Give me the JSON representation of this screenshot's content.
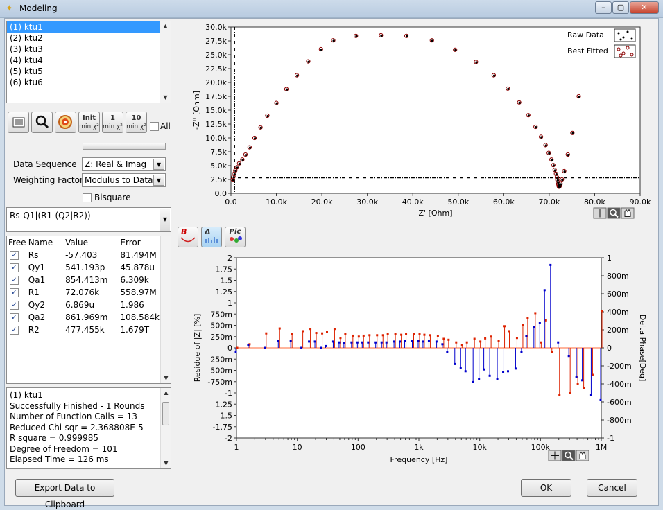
{
  "window": {
    "title": "Modeling"
  },
  "datasets": [
    "(1) ktu1",
    "(2) ktu2",
    "(3) ktu3",
    "(4) ktu4",
    "(5) ktu5",
    "(6) ktu6"
  ],
  "toolbar": {
    "init_label": "Init",
    "init_sub": "min χ²",
    "one_label": "1",
    "one_sub": "min χ²",
    "ten_label": "10",
    "ten_sub": "min χ²",
    "all_label": "All"
  },
  "settings": {
    "data_sequence_label": "Data Sequence",
    "data_sequence_value": "Z: Real & Imag",
    "weighting_label": "Weighting Factor",
    "weighting_value": "Modulus to Data",
    "bisquare_label": "Bisquare"
  },
  "circuit": {
    "value": "Rs-Q1|(R1-(Q2|R2))"
  },
  "params": {
    "headers": [
      "Free",
      "Name",
      "Value",
      "Error"
    ],
    "rows": [
      [
        "Rs",
        "-57.403",
        "81.494M"
      ],
      [
        "Qy1",
        "541.193p",
        "45.878u"
      ],
      [
        "Qa1",
        "854.413m",
        "6.309k"
      ],
      [
        "R1",
        "72.076k",
        "558.97M"
      ],
      [
        "Qy2",
        "6.869u",
        "1.986"
      ],
      [
        "Qa2",
        "861.969m",
        "108.584k"
      ],
      [
        "R2",
        "477.455k",
        "1.679T"
      ]
    ]
  },
  "log": {
    "lines": [
      "(1) ktu1",
      "Successfully Finished - 1 Rounds",
      "Number of Function Calls = 13",
      "Reduced Chi-sqr = 2.368808E-5",
      "R square = 0.999985",
      "Degree of Freedom = 101",
      "Elapsed Time = 126 ms"
    ]
  },
  "buttons": {
    "export": "Export Data to Clipboard",
    "ok": "OK",
    "cancel": "Cancel"
  },
  "midtools": {
    "b": "B",
    "delta": "Δ",
    "pic": "Pic"
  },
  "colors": {
    "raw": "#000000",
    "fit": "#8b0000",
    "residual_z": "#dd2200",
    "residual_phase": "#0000cc",
    "accent": "#3399ff"
  },
  "chart_data": [
    {
      "type": "scatter",
      "title": "",
      "xlabel": "Z' [Ohm]",
      "ylabel": "-Z'' [Ohm]",
      "xlim": [
        0,
        90000
      ],
      "ylim": [
        0,
        30000
      ],
      "x_ticks": [
        "0.0",
        "10.0k",
        "20.0k",
        "30.0k",
        "40.0k",
        "50.0k",
        "60.0k",
        "70.0k",
        "80.0k",
        "90.0k"
      ],
      "y_ticks": [
        "0.0",
        "2.5k",
        "5.0k",
        "7.5k",
        "10.0k",
        "12.5k",
        "15.0k",
        "17.5k",
        "20.0k",
        "22.5k",
        "25.0k",
        "27.5k",
        "30.0k"
      ],
      "legend_position": "top-right",
      "grid": false,
      "cursor": {
        "x": 800,
        "y": 2800
      },
      "series": [
        {
          "name": "Raw Data",
          "x": [
            400,
            550,
            700,
            950,
            1300,
            1800,
            2500,
            3200,
            4100,
            5200,
            6500,
            8000,
            10000,
            12200,
            14500,
            17000,
            19800,
            22500,
            27500,
            33000,
            38600,
            44200,
            49300,
            53900,
            57800,
            60900,
            63400,
            65400,
            67000,
            68200,
            69200,
            69900,
            70500,
            70900,
            71200,
            71500,
            71700,
            71800,
            71900,
            72000,
            72050,
            72100,
            72150,
            72200,
            72300,
            72500,
            72800,
            73300,
            74100,
            75100,
            76500
          ],
          "y": [
            2500,
            3000,
            3500,
            4100,
            4700,
            5400,
            6100,
            7000,
            8300,
            10000,
            11900,
            14000,
            16300,
            18800,
            21300,
            23800,
            26000,
            27600,
            28400,
            28500,
            28400,
            27600,
            25900,
            23700,
            21300,
            18900,
            16400,
            14100,
            12000,
            10200,
            8700,
            7300,
            6100,
            5100,
            4200,
            3500,
            2900,
            2400,
            2000,
            1700,
            1500,
            1300,
            1200,
            1200,
            1300,
            1700,
            2500,
            4000,
            7000,
            10900,
            17500
          ]
        },
        {
          "name": "Best Fitted",
          "x": [
            400,
            550,
            700,
            950,
            1300,
            1800,
            2500,
            3200,
            4100,
            5200,
            6500,
            8000,
            10000,
            12200,
            14500,
            17000,
            19800,
            22500,
            27500,
            33000,
            38600,
            44200,
            49300,
            53900,
            57800,
            60900,
            63400,
            65400,
            67000,
            68200,
            69200,
            69900,
            70500,
            70900,
            71200,
            71500,
            71700,
            71800,
            71900,
            72000,
            72050,
            72100,
            72150,
            72200,
            72300,
            72500,
            72800,
            73300,
            74100,
            75100,
            76500
          ],
          "y": [
            2500,
            3000,
            3500,
            4100,
            4700,
            5400,
            6100,
            7000,
            8300,
            10000,
            11900,
            14000,
            16300,
            18800,
            21300,
            23800,
            26000,
            27600,
            28400,
            28500,
            28400,
            27600,
            25900,
            23700,
            21300,
            18900,
            16400,
            14100,
            12000,
            10200,
            8700,
            7300,
            6100,
            5100,
            4200,
            3500,
            2900,
            2400,
            2000,
            1700,
            1500,
            1300,
            1200,
            1200,
            1300,
            1700,
            2500,
            4000,
            7000,
            10900,
            17500
          ]
        }
      ]
    },
    {
      "type": "scatter",
      "title": "",
      "xlabel": "Frequency [Hz]",
      "ylabel": "Residue of |Z| [%]",
      "y2label": "Delta Phase[Deg]",
      "xscale": "log",
      "xlim": [
        1,
        1000000
      ],
      "ylim": [
        -2,
        2
      ],
      "y2lim": [
        -1,
        1
      ],
      "x_ticks": [
        "1",
        "10",
        "100",
        "1k",
        "10k",
        "100k",
        "1M"
      ],
      "y_ticks": [
        "-2",
        "-1.75",
        "-1.5",
        "-1.25",
        "-1",
        "-750m",
        "-500m",
        "-250m",
        "0",
        "250m",
        "500m",
        "750m",
        "1",
        "1.25",
        "1.5",
        "1.75",
        "2"
      ],
      "y2_ticks": [
        "-1",
        "-800m",
        "-600m",
        "-400m",
        "-200m",
        "0",
        "200m",
        "400m",
        "600m",
        "800m",
        "1"
      ],
      "series": [
        {
          "name": "Residue of |Z| [%]",
          "axis": "left",
          "x": [
            1,
            1.6,
            3,
            5,
            8,
            12,
            16,
            20,
            25,
            30,
            40,
            50,
            60,
            80,
            100,
            120,
            150,
            200,
            250,
            300,
            400,
            500,
            600,
            800,
            1000,
            1200,
            1500,
            2000,
            2500,
            3000,
            4000,
            5000,
            6000,
            8000,
            10000,
            12000,
            15000,
            20000,
            25000,
            30000,
            40000,
            50000,
            60000,
            80000,
            100000,
            120000,
            150000,
            200000,
            300000,
            400000,
            500000,
            700000,
            1000000
          ],
          "y": [
            0,
            0.08,
            0.32,
            0.43,
            0.3,
            0.37,
            0.42,
            0.33,
            0.32,
            0.35,
            0.42,
            0.22,
            0.3,
            0.27,
            0.25,
            0.27,
            0.28,
            0.28,
            0.28,
            0.3,
            0.3,
            0.29,
            0.3,
            0.31,
            0.31,
            0.29,
            0.28,
            0.26,
            0.2,
            0.18,
            0.12,
            0.06,
            0.12,
            0.2,
            0.14,
            0.21,
            0.25,
            0.16,
            0.48,
            0.37,
            0.22,
            0.51,
            0.66,
            0.77,
            0.12,
            0.61,
            -0.1,
            -1.05,
            -1.0,
            -0.8,
            -0.9,
            -0.6,
            0.82
          ]
        },
        {
          "name": "Delta Phase[Deg]",
          "axis": "right",
          "x": [
            1,
            1.6,
            3,
            5,
            8,
            12,
            16,
            20,
            25,
            30,
            40,
            50,
            60,
            80,
            100,
            120,
            150,
            200,
            250,
            300,
            400,
            500,
            600,
            800,
            1000,
            1200,
            1500,
            2000,
            2500,
            3000,
            4000,
            5000,
            6000,
            8000,
            10000,
            12000,
            15000,
            20000,
            25000,
            30000,
            40000,
            50000,
            60000,
            80000,
            100000,
            120000,
            150000,
            200000,
            300000,
            400000,
            500000,
            700000,
            1000000
          ],
          "y": [
            -0.05,
            0.03,
            0.0,
            0.08,
            0.08,
            0.0,
            0.07,
            0.07,
            0.0,
            0.02,
            0.07,
            0.06,
            0.05,
            0.06,
            0.06,
            0.06,
            0.06,
            0.06,
            0.06,
            0.06,
            0.07,
            0.07,
            0.08,
            0.08,
            0.08,
            0.07,
            0.08,
            0.07,
            0.04,
            -0.05,
            -0.18,
            -0.22,
            -0.26,
            -0.38,
            -0.35,
            -0.24,
            -0.31,
            -0.35,
            -0.27,
            -0.26,
            -0.23,
            -0.05,
            0.13,
            0.23,
            0.28,
            0.64,
            0.92,
            0.06,
            -0.09,
            -0.32,
            -0.36,
            -0.52,
            -0.58
          ]
        }
      ]
    }
  ]
}
